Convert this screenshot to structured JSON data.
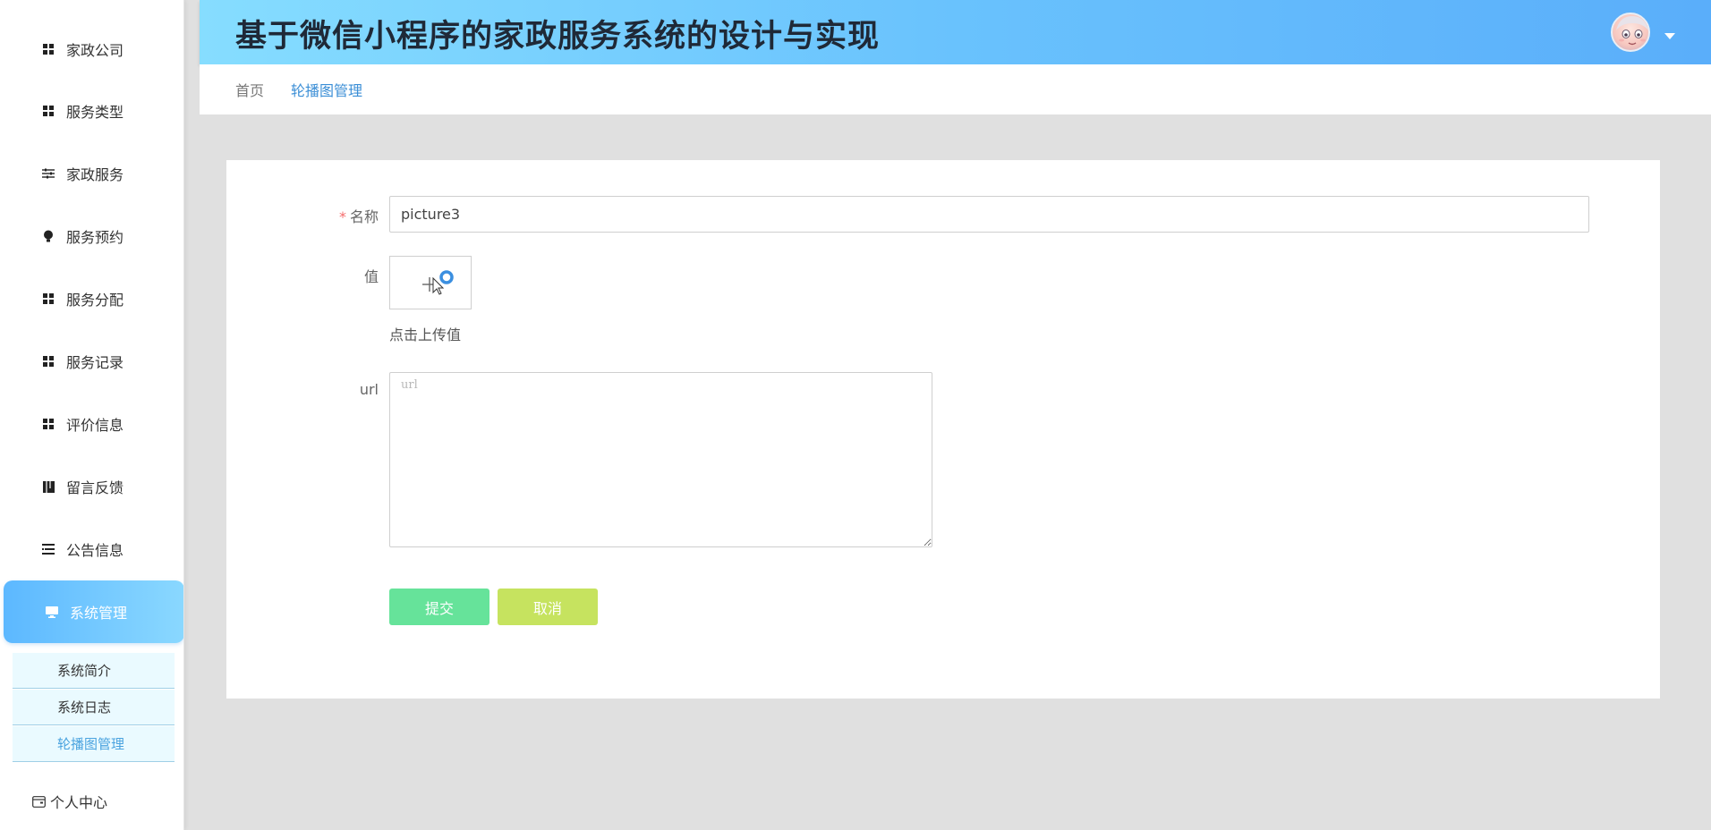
{
  "app": {
    "title": "基于微信小程序的家政服务系统的设计与实现"
  },
  "sidebar": {
    "items": [
      {
        "label": "家政公司",
        "icon": "grid-icon"
      },
      {
        "label": "服务类型",
        "icon": "grid-icon"
      },
      {
        "label": "家政服务",
        "icon": "sliders-icon"
      },
      {
        "label": "服务预约",
        "icon": "bulb-icon"
      },
      {
        "label": "服务分配",
        "icon": "grid-icon"
      },
      {
        "label": "服务记录",
        "icon": "grid-icon"
      },
      {
        "label": "评价信息",
        "icon": "grid-icon"
      },
      {
        "label": "留言反馈",
        "icon": "book-icon"
      },
      {
        "label": "公告信息",
        "icon": "list-icon"
      },
      {
        "label": "系统管理",
        "icon": "monitor-icon",
        "active": true
      }
    ],
    "submenu": [
      {
        "label": "系统简介"
      },
      {
        "label": "系统日志"
      },
      {
        "label": "轮播图管理",
        "current": true
      }
    ],
    "personal": {
      "label": "个人中心",
      "icon": "wallet-icon"
    }
  },
  "breadcrumb": {
    "home": "首页",
    "current": "轮播图管理"
  },
  "form": {
    "name_label": "名称",
    "required_mark": "*",
    "name_value": "picture3",
    "value_label": "值",
    "upload_hint": "点击上传值",
    "url_label": "url",
    "url_placeholder": "url",
    "submit_label": "提交",
    "cancel_label": "取消"
  },
  "colors": {
    "header_gradient_start": "#86ddff",
    "header_gradient_end": "#5aaefa",
    "active_menu": "#5cb8ff",
    "breadcrumb_current": "#3a8ed6",
    "submit_button": "#66e39a",
    "cancel_button": "#c6e35f",
    "required": "#f56c6c"
  }
}
